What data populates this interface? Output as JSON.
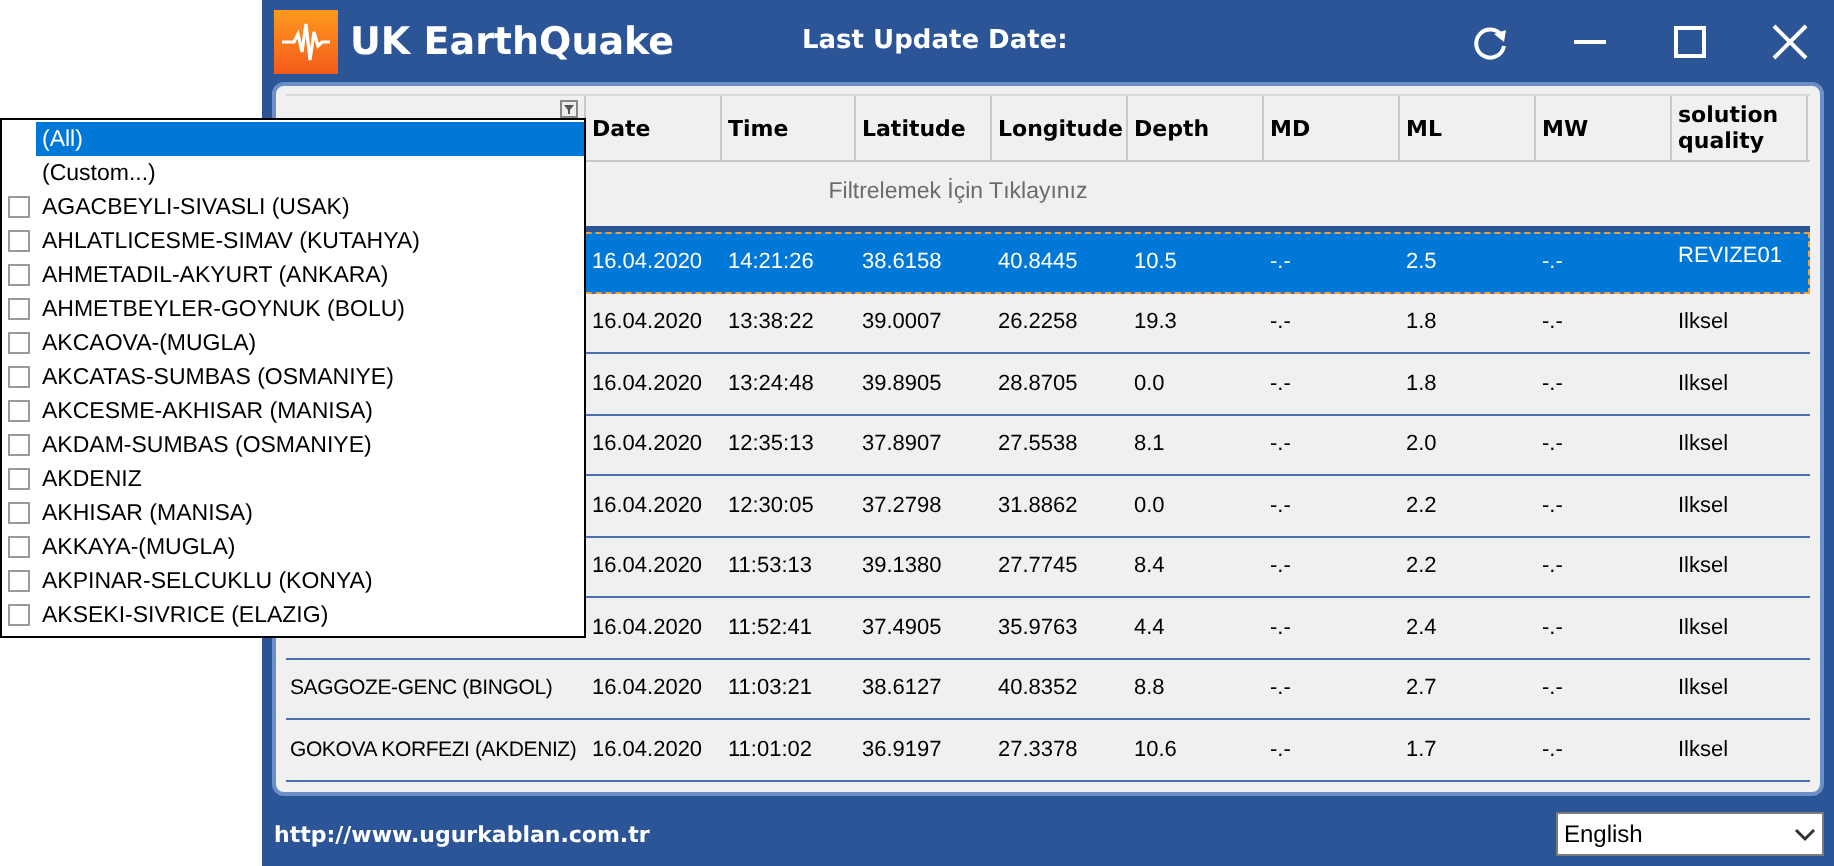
{
  "window": {
    "title": "UK EarthQuake",
    "last_update_label": "Last Update Date:"
  },
  "table": {
    "columns": [
      "Date",
      "Time",
      "Latitude",
      "Longitude",
      "Depth",
      "MD",
      "ML",
      "MW",
      "solution quality"
    ],
    "filter_hint": "Filtrelemek İçin Tıklayınız",
    "rows": [
      {
        "selected": true,
        "cells": [
          "16.04.2020",
          "14:21:26",
          "38.6158",
          "40.8445",
          "10.5",
          "-.-",
          "2.5",
          "-.-",
          "REVIZE01"
        ]
      },
      {
        "selected": false,
        "cells": [
          "16.04.2020",
          "13:38:22",
          "39.0007",
          "26.2258",
          "19.3",
          "-.-",
          "1.8",
          "-.-",
          "Ilksel"
        ]
      },
      {
        "selected": false,
        "cells": [
          "16.04.2020",
          "13:24:48",
          "39.8905",
          "28.8705",
          "0.0",
          "-.-",
          "1.8",
          "-.-",
          "Ilksel"
        ]
      },
      {
        "selected": false,
        "cells": [
          "16.04.2020",
          "12:35:13",
          "37.8907",
          "27.5538",
          "8.1",
          "-.-",
          "2.0",
          "-.-",
          "Ilksel"
        ]
      },
      {
        "selected": false,
        "cells": [
          "16.04.2020",
          "12:30:05",
          "37.2798",
          "31.8862",
          "0.0",
          "-.-",
          "2.2",
          "-.-",
          "Ilksel"
        ]
      },
      {
        "selected": false,
        "cells": [
          "16.04.2020",
          "11:53:13",
          "39.1380",
          "27.7745",
          "8.4",
          "-.-",
          "2.2",
          "-.-",
          "Ilksel"
        ]
      },
      {
        "selected": false,
        "cells": [
          "16.04.2020",
          "11:52:41",
          "37.4905",
          "35.9763",
          "4.4",
          "-.-",
          "2.4",
          "-.-",
          "Ilksel"
        ]
      },
      {
        "selected": false,
        "location": "SAGGOZE-GENC (BINGOL)",
        "cells": [
          "16.04.2020",
          "11:03:21",
          "38.6127",
          "40.8352",
          "8.8",
          "-.-",
          "2.7",
          "-.-",
          "Ilksel"
        ]
      },
      {
        "selected": false,
        "location": "GOKOVA KORFEZI (AKDENIZ)",
        "cells": [
          "16.04.2020",
          "11:01:02",
          "36.9197",
          "27.3378",
          "10.6",
          "-.-",
          "1.7",
          "-.-",
          "Ilksel"
        ]
      }
    ]
  },
  "filter_dropdown": {
    "items": [
      {
        "kind": "option",
        "label": "(All)",
        "selected": true
      },
      {
        "kind": "option",
        "label": "(Custom...)",
        "selected": false
      },
      {
        "kind": "checkbox",
        "label": "AGACBEYLI-SIVASLI (USAK)",
        "checked": false
      },
      {
        "kind": "checkbox",
        "label": "AHLATLICESME-SIMAV (KUTAHYA)",
        "checked": false
      },
      {
        "kind": "checkbox",
        "label": "AHMETADIL-AKYURT (ANKARA)",
        "checked": false
      },
      {
        "kind": "checkbox",
        "label": "AHMETBEYLER-GOYNUK (BOLU)",
        "checked": false
      },
      {
        "kind": "checkbox",
        "label": "AKCAOVA-(MUGLA)",
        "checked": false
      },
      {
        "kind": "checkbox",
        "label": "AKCATAS-SUMBAS (OSMANIYE)",
        "checked": false
      },
      {
        "kind": "checkbox",
        "label": "AKCESME-AKHISAR (MANISA)",
        "checked": false
      },
      {
        "kind": "checkbox",
        "label": "AKDAM-SUMBAS (OSMANIYE)",
        "checked": false
      },
      {
        "kind": "checkbox",
        "label": "AKDENIZ",
        "checked": false
      },
      {
        "kind": "checkbox",
        "label": "AKHISAR (MANISA)",
        "checked": false
      },
      {
        "kind": "checkbox",
        "label": "AKKAYA-(MUGLA)",
        "checked": false
      },
      {
        "kind": "checkbox",
        "label": "AKPINAR-SELCUKLU (KONYA)",
        "checked": false
      },
      {
        "kind": "checkbox",
        "label": "AKSEKI-SIVRICE (ELAZIG)",
        "checked": false
      }
    ]
  },
  "footer": {
    "url": "http://www.ugurkablan.com.tr",
    "language": "English"
  }
}
